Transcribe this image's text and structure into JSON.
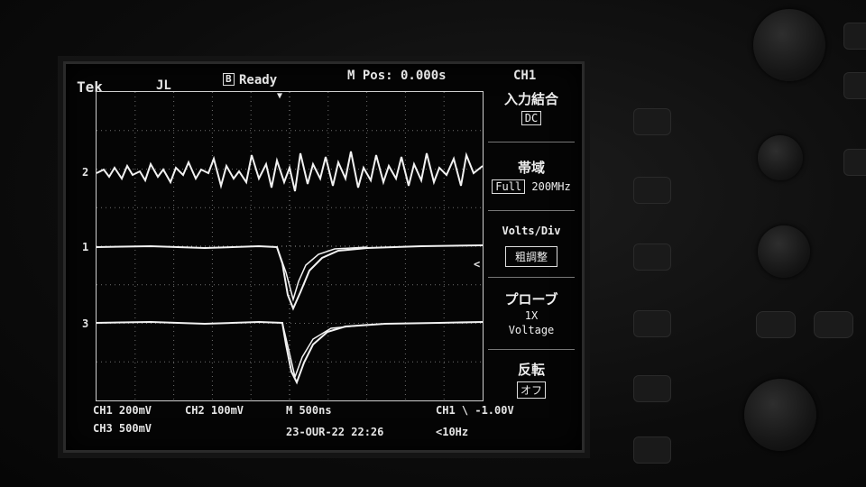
{
  "header": {
    "brand": "Tek",
    "trigger_icon": "JL",
    "status": "Ready",
    "status_marker": "B",
    "position": "M Pos: 0.000s",
    "channel": "CH1"
  },
  "menu": {
    "items": [
      {
        "label": "入力結合",
        "value": "DC"
      },
      {
        "label": "帯域",
        "value": "200MHz",
        "value_prefix": "Full"
      },
      {
        "label": "Volts/Div",
        "value": "粗調整"
      },
      {
        "label": "プローブ",
        "value": "1X",
        "value2": "Voltage"
      },
      {
        "label": "反転",
        "value": "オフ"
      }
    ]
  },
  "footer": {
    "ch1_scale": "CH1 200mV",
    "ch2_scale": "CH2 100mV",
    "timebase": "M 500ns",
    "trigger": "CH1 \\ -1.00V",
    "ch3_scale": "CH3 500mV",
    "timestamp": "23-OUR-22 22:26",
    "freq": "<10Hz"
  },
  "channels": {
    "markers": [
      "2",
      "1",
      "3"
    ]
  },
  "colors": {
    "trace": "#f2f2f2",
    "grid": "#8a8a8a",
    "screen_bg": "#050505"
  }
}
